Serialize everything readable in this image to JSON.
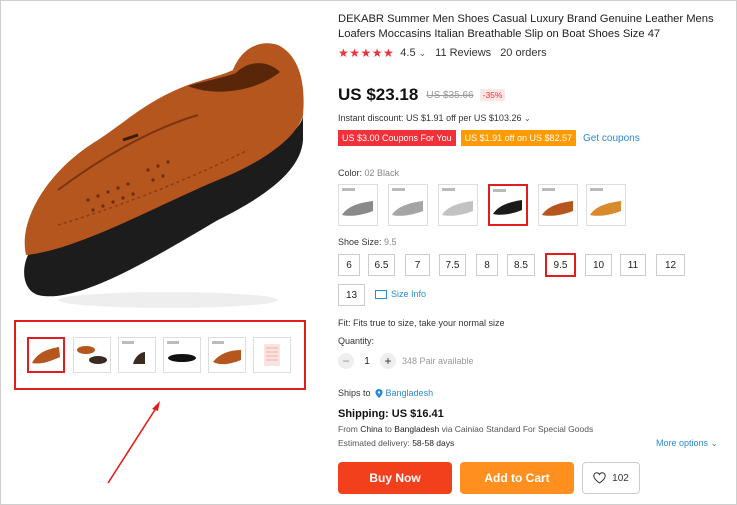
{
  "product": {
    "title": "DEKABR Summer Men Shoes Casual Luxury Brand Genuine Leather Mens Loafers Moccasins Italian Breathable Slip on Boat Shoes Size 47",
    "rating": "4.5",
    "reviews": "11 Reviews",
    "orders": "20 orders",
    "price": "US $23.18",
    "original_price": "US $35.66",
    "discount": "-35%",
    "instant_discount": "Instant discount: US $1.91 off per US $103.26",
    "coupons": [
      "US $3.00 Coupons For You",
      "US $1.91 off on US $82.57"
    ],
    "get_coupons": "Get coupons",
    "color_label": "Color:",
    "color_selected": "02 Black",
    "size_label": "Shoe Size:",
    "size_selected": "9.5",
    "sizes": [
      "6",
      "6.5",
      "7",
      "7.5",
      "8",
      "8.5",
      "9.5",
      "10",
      "11",
      "12",
      "13"
    ],
    "size_info": "Size Info",
    "fit": "Fit: Fits true to size, take your normal size",
    "quantity_label": "Quantity:",
    "quantity_value": "1",
    "available": "348 Pair available",
    "ships_to_label": "Ships to",
    "ships_to_country": "Bangladesh",
    "shipping": "Shipping: US $16.41",
    "from_prefix": "From",
    "from_country": "China",
    "to_word": "to",
    "to_country": "Bangladesh",
    "via_text": "via Cainiao Standard For Special Goods",
    "estimated_label": "Estimated delivery:",
    "estimated_value": "58-58 days",
    "more_options": "More options",
    "buy_now": "Buy Now",
    "add_to_cart": "Add to Cart",
    "wishlist_count": "102"
  },
  "colors": {
    "accent_red": "#f0313a",
    "highlight_red": "#e01e1e",
    "buy_now": "#f23f1c",
    "add_to_cart": "#ff8f1f",
    "link_blue": "#2a8ad5",
    "leather": "#b5561f"
  },
  "icons": [
    "star-icon",
    "chevron-down-icon",
    "ruler-icon",
    "location-pin-icon",
    "heart-icon",
    "minus-icon",
    "plus-icon",
    "annotation-arrow"
  ]
}
